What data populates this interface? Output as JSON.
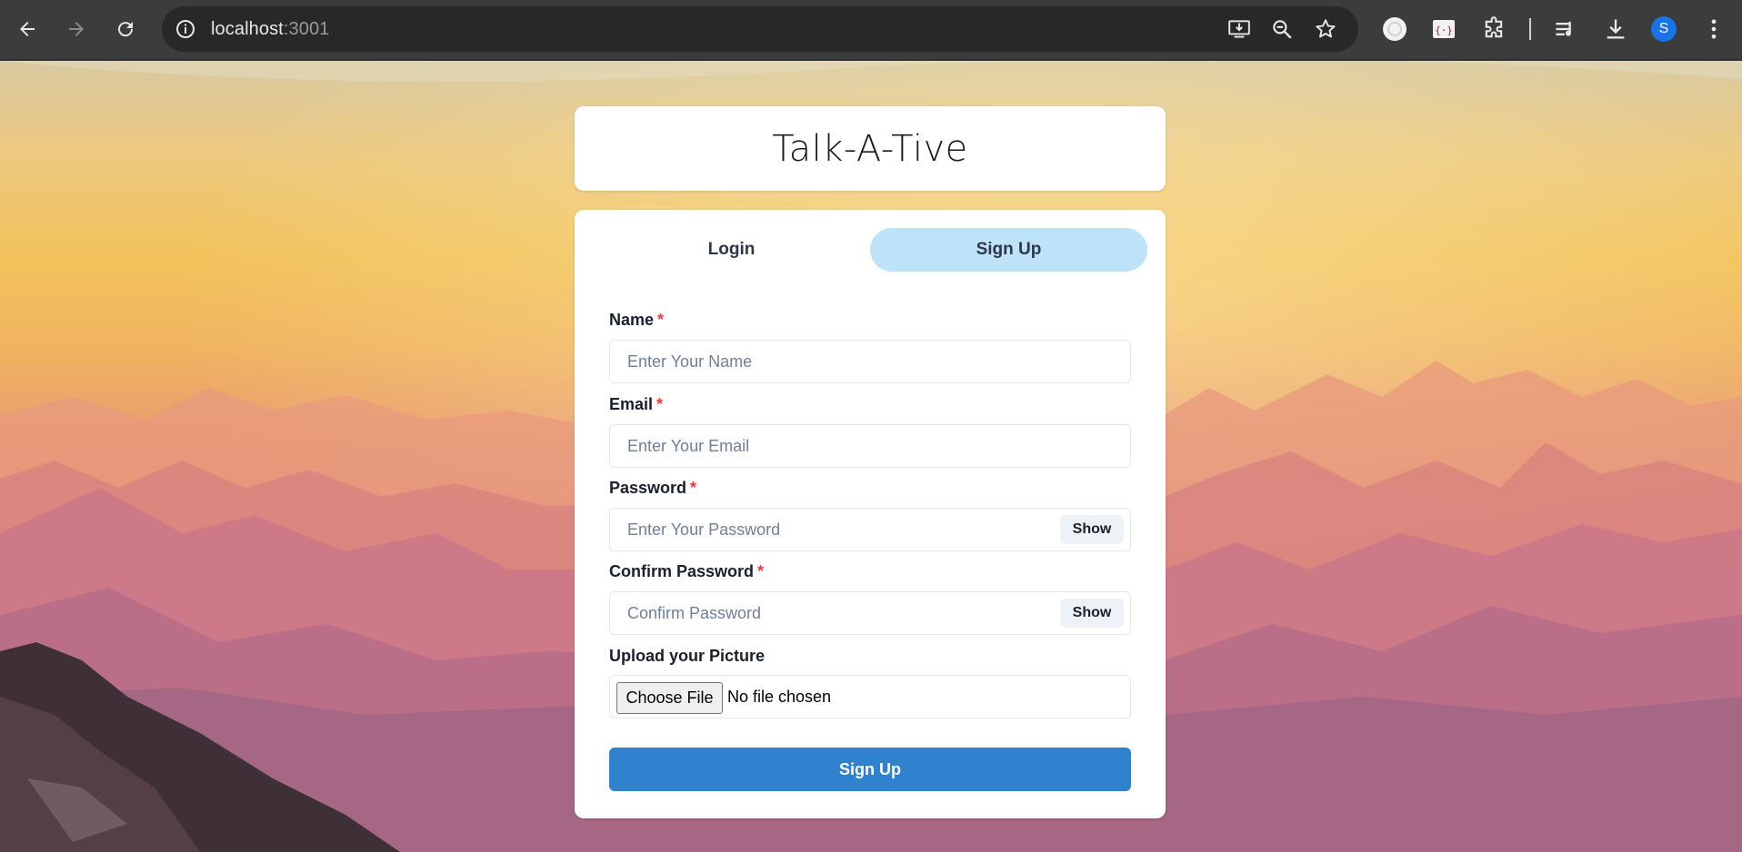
{
  "browser": {
    "url_host": "localhost",
    "url_port": ":3001",
    "profile_initial": "S",
    "icons": [
      "back-arrow-icon",
      "forward-arrow-icon",
      "reload-icon",
      "site-info-icon",
      "install-app-icon",
      "zoom-icon",
      "bookmark-star-icon",
      "extension-icon",
      "extension-devtools-icon",
      "extensions-puzzle-icon",
      "media-queue-icon",
      "downloads-icon",
      "menu-dots-icon"
    ]
  },
  "app": {
    "title": "Talk-A-Tive"
  },
  "tabs": {
    "login": "Login",
    "signup": "Sign Up",
    "active": "signup"
  },
  "form": {
    "name": {
      "label": "Name",
      "required": "*",
      "placeholder": "Enter Your Name"
    },
    "email": {
      "label": "Email",
      "required": "*",
      "placeholder": "Enter Your Email"
    },
    "password": {
      "label": "Password",
      "required": "*",
      "placeholder": "Enter Your Password",
      "toggle": "Show"
    },
    "confirm": {
      "label": "Confirm Password",
      "required": "*",
      "placeholder": "Confirm Password",
      "toggle": "Show"
    },
    "picture": {
      "label": "Upload your Picture",
      "button": "Choose File",
      "status": "No file chosen"
    },
    "submit": "Sign Up"
  },
  "colors": {
    "accent": "#3182ce",
    "tab_active": "#bee3f8",
    "required": "#e53e3e"
  }
}
